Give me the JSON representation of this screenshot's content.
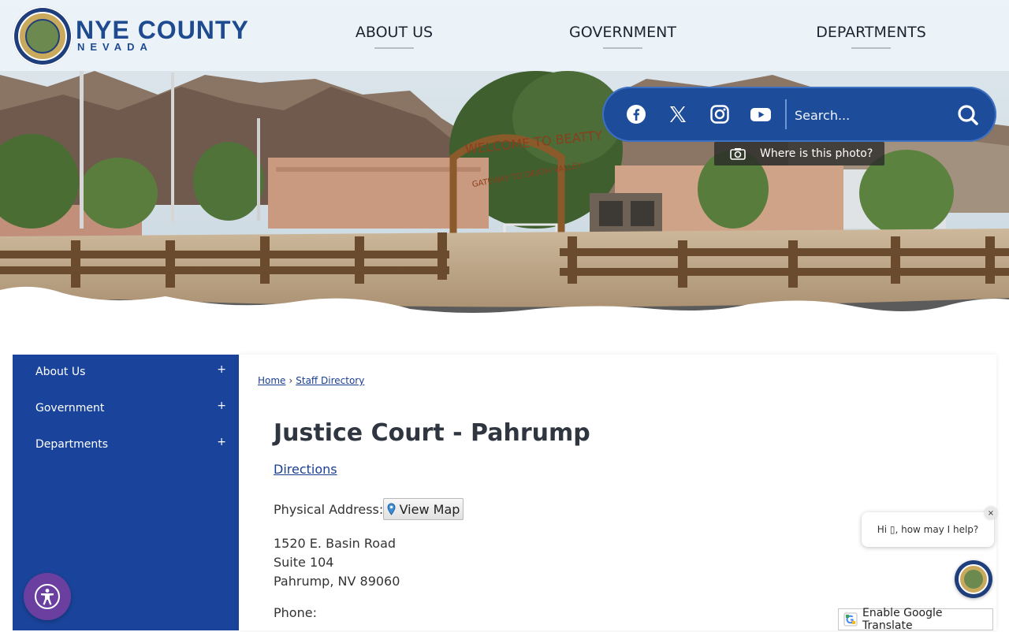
{
  "header": {
    "logo_name": "NYE COUNTY",
    "logo_state": "NEVADA",
    "nav": [
      {
        "label": "ABOUT US"
      },
      {
        "label": "GOVERNMENT"
      },
      {
        "label": "DEPARTMENTS"
      }
    ]
  },
  "social": [
    "facebook-icon",
    "x-icon",
    "instagram-icon",
    "youtube-icon"
  ],
  "search": {
    "placeholder": "Search..."
  },
  "hero": {
    "photo_button": "Where is this photo?",
    "arch_sign": "WELCOME TO BEATTY",
    "arch_sub": "GATEWAY TO DEATH VALLEY"
  },
  "sidebar": {
    "items": [
      {
        "label": "About Us",
        "toggle": "+"
      },
      {
        "label": "Government",
        "toggle": "+"
      },
      {
        "label": "Departments",
        "toggle": "+"
      }
    ]
  },
  "breadcrumb": {
    "home": "Home",
    "separator": "›",
    "current": "Staff Directory"
  },
  "page": {
    "title": "Justice Court - Pahrump",
    "directions": "Directions",
    "physical_label": "Physical Address:",
    "view_map": "View Map",
    "address_lines": [
      "1520 E. Basin Road",
      "Suite 104",
      "Pahrump, NV 89060"
    ],
    "phone_label": "Phone:"
  },
  "chat": {
    "greeting": "Hi ▯, how may I help?",
    "close": "×"
  },
  "translate": {
    "label": "Enable Google Translate"
  },
  "colors": {
    "brand_blue": "#1a449b",
    "link": "#1a3f8f",
    "accessibility_purple": "#6b3fa0"
  }
}
